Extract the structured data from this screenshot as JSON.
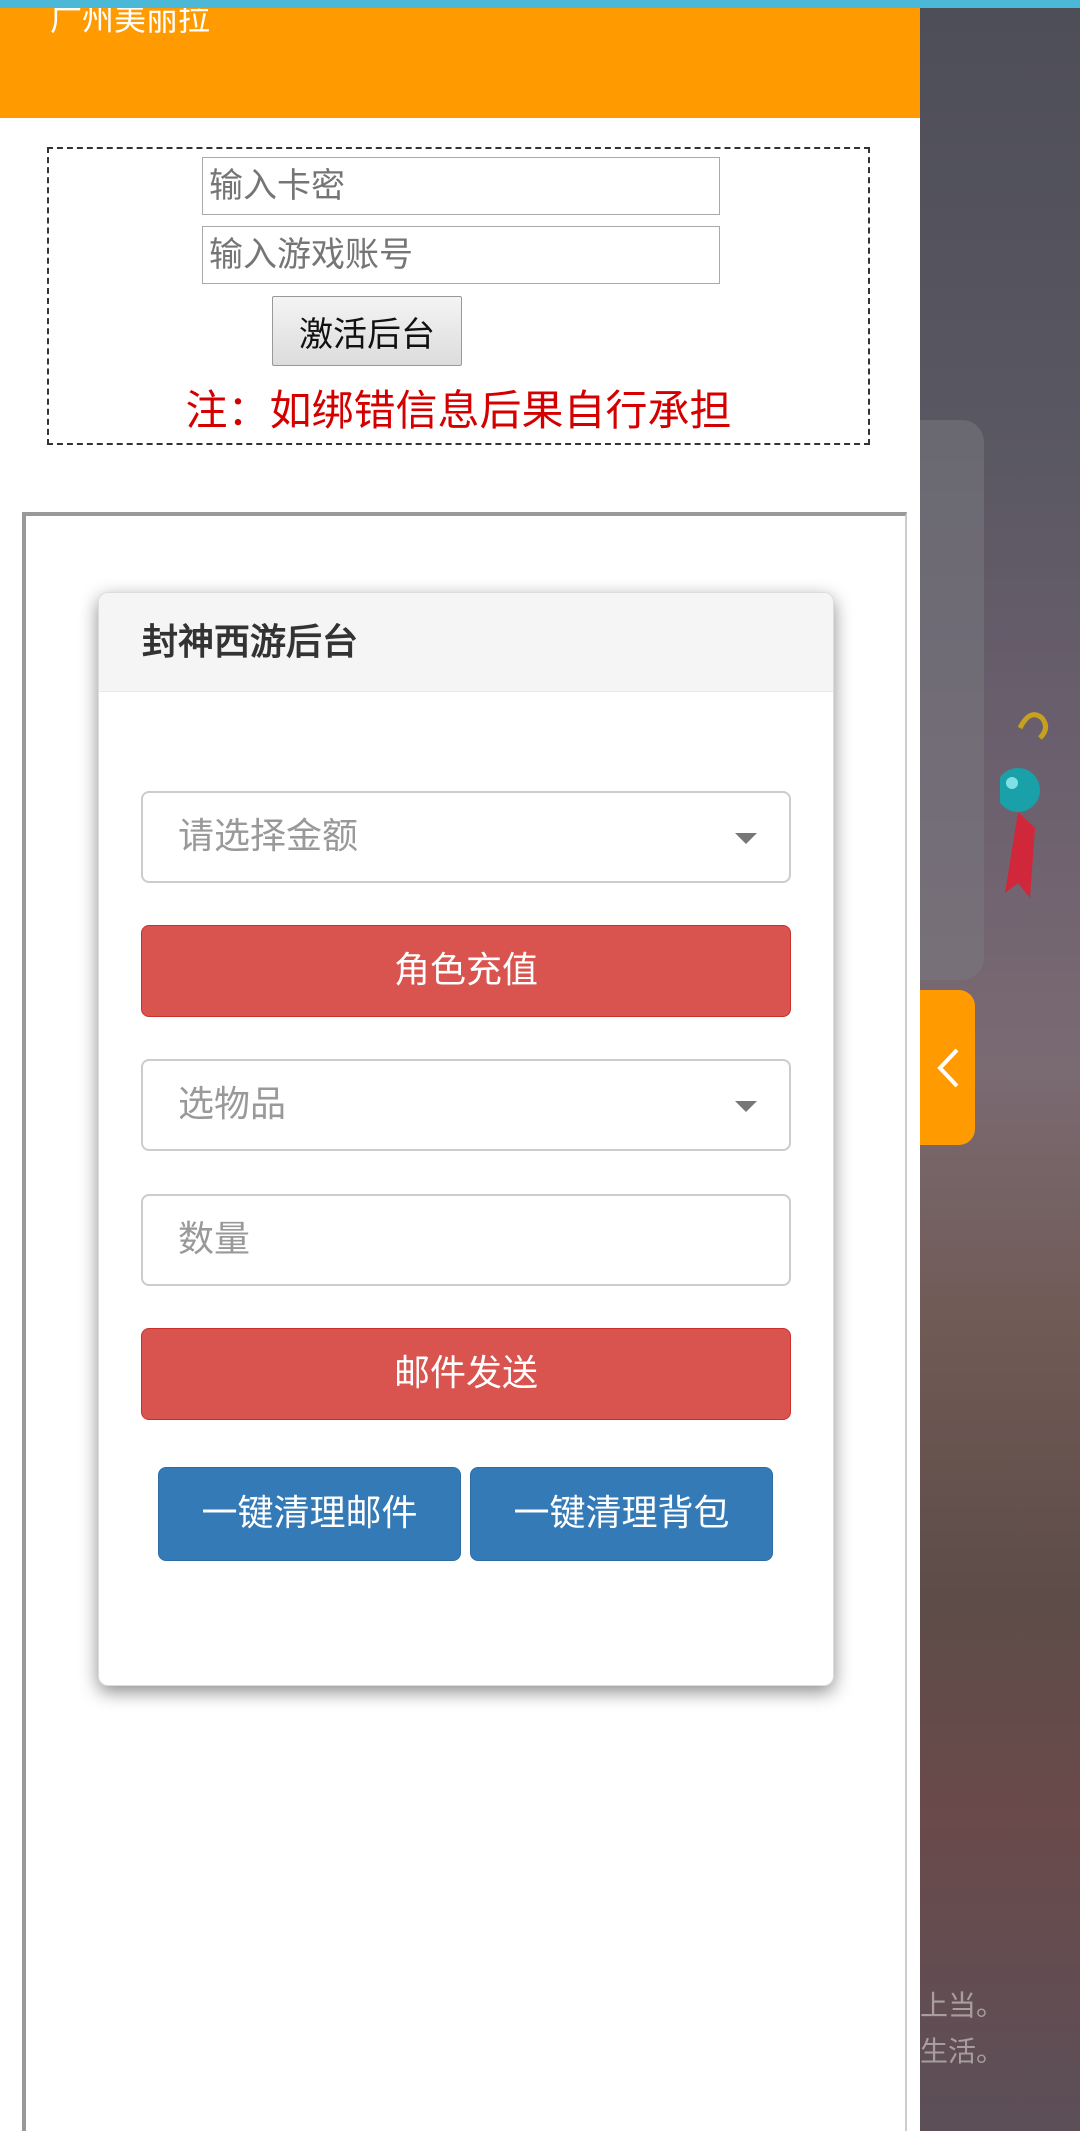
{
  "header": {
    "partial_text": "广州美丽拉"
  },
  "activation": {
    "card_key_placeholder": "输入卡密",
    "account_placeholder": "输入游戏账号",
    "activate_label": "激活后台",
    "note": "注：如绑错信息后果自行承担"
  },
  "panel": {
    "title": "封神西游后台",
    "amount_select_placeholder": "请选择金额",
    "recharge_label": "角色充值",
    "item_select_placeholder": "选物品",
    "quantity_placeholder": "数量",
    "send_mail_label": "邮件发送",
    "clear_mail_label": "一键清理邮件",
    "clear_bag_label": "一键清理背包"
  },
  "background": {
    "footer_line1": "上当。",
    "footer_line2": "生活。"
  },
  "colors": {
    "accent_orange": "#ff9a00",
    "danger_red": "#d9534f",
    "primary_blue": "#337ab7",
    "note_red": "#d40000"
  },
  "icons": {
    "side_tab": "chevron-left-icon",
    "select_caret": "caret-down-icon"
  }
}
